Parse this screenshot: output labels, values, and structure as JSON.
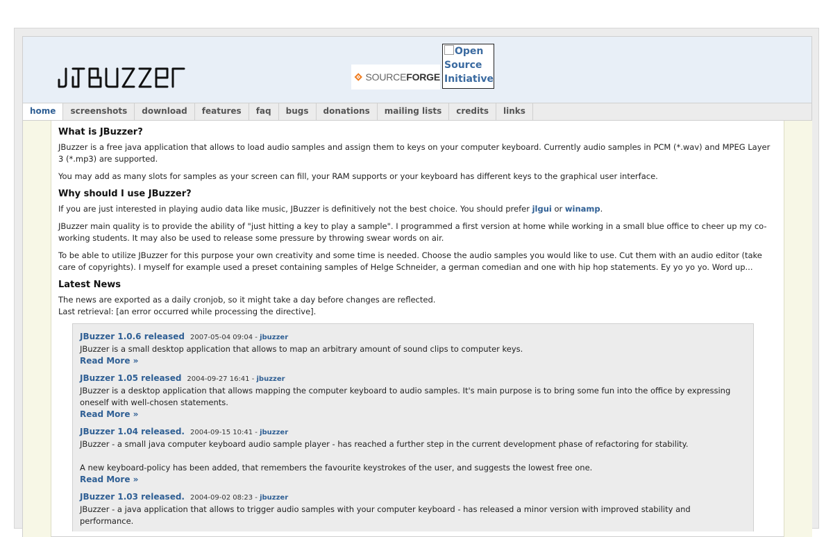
{
  "header": {
    "logo_text": "JBuzzer",
    "sourceforge": {
      "part1": "SOURCE",
      "part2": "FORGE"
    },
    "osi_alt": "Open Source Initiative"
  },
  "nav": {
    "items": [
      "home",
      "screenshots",
      "download",
      "features",
      "faq",
      "bugs",
      "donations",
      "mailing lists",
      "credits",
      "links"
    ],
    "active": "home"
  },
  "sections": {
    "what": {
      "heading": "What is JBuzzer?",
      "p1": "JBuzzer is a free java application that allows to load audio samples and assign them to keys on your computer keyboard. Currently audio samples in PCM (*.wav) and MPEG Layer 3 (*.mp3) are supported.",
      "p2": "You may add as many slots for samples as your screen can fill, your RAM supports or your keyboard has different keys to the graphical user interface."
    },
    "why": {
      "heading": "Why should I use JBuzzer?",
      "p1_before": "If you are just interested in playing audio data like music, JBuzzer is definitively not the best choice. You should prefer ",
      "link1": "jlgui",
      "p1_mid": " or ",
      "link2": "winamp",
      "p1_after": ".",
      "p2": "JBuzzer main quality is to provide the ability of \"just hitting a key to play a sample\". I programmed a first version at home while working in a small blue office to cheer up my co-working students. It may also be used to release some pressure by throwing swear words on air.",
      "p3": "To be able to utilize JBuzzer for this purpose your own creativity and some time is needed. Choose the audio samples you would like to use. Cut them with an audio editor (take care of copyrights). I myself for example used a preset containing samples of Helge Schneider, a german comedian and one with hip hop statements. Ey yo yo yo. Word up..."
    },
    "news": {
      "heading": "Latest News",
      "intro1": "The news are exported as a daily cronjob, so it might take a day before changes are reflected.",
      "intro2": "Last retrieval: [an error occurred while processing the directive].",
      "read_more": "Read More »",
      "items": [
        {
          "title": "JBuzzer 1.0.6 released",
          "date": "2007-05-04 09:04 - ",
          "author": "jbuzzer",
          "body": "JBuzzer is a small desktop application that allows to map an arbitrary amount of sound clips to computer keys."
        },
        {
          "title": "JBuzzer 1.05 released",
          "date": "2004-09-27 16:41 - ",
          "author": "jbuzzer",
          "body": "JBuzzer is a desktop application that allows mapping the computer keyboard to audio samples. It's main purpose is to bring some fun into the office by expressing oneself with well-chosen statements."
        },
        {
          "title": "JBuzzer 1.04 released.",
          "date": "2004-09-15 10:41 - ",
          "author": "jbuzzer",
          "body": "JBuzzer - a small java computer keyboard audio sample player - has reached a further step in the current development phase of refactoring for stability.",
          "body2": "A new keyboard-policy has been added, that remembers the favourite keystrokes of the user, and suggests the lowest free one."
        },
        {
          "title": "JBuzzer 1.03 released.",
          "date": "2004-09-02 08:23 - ",
          "author": "jbuzzer",
          "body": "JBuzzer - a java application that allows to trigger audio samples with your computer keyboard - has released a minor version with improved stability and performance."
        }
      ]
    }
  }
}
